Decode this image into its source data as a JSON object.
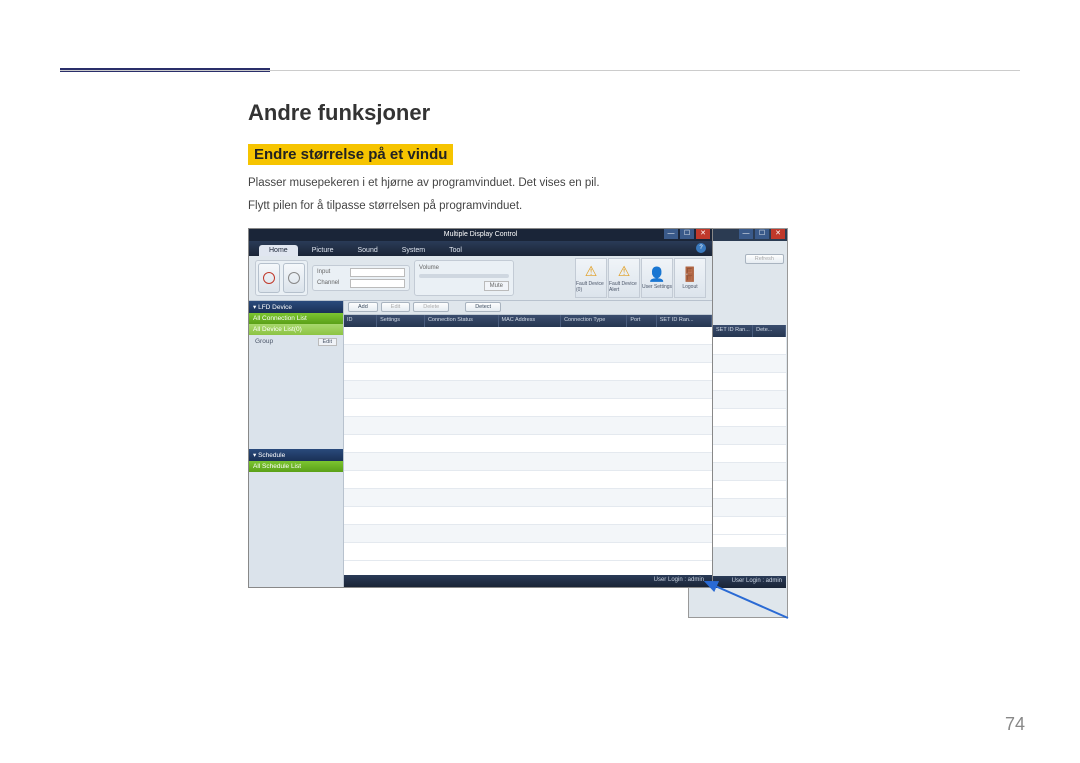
{
  "page": {
    "heading1": "Andre funksjoner",
    "heading2": "Endre størrelse på et vindu",
    "para1": "Plasser musepekeren i et hjørne av programvinduet. Det vises en pil.",
    "para2": "Flytt pilen for å tilpasse størrelsen på programvinduet.",
    "page_number": "74"
  },
  "app": {
    "title": "Multiple Display Control",
    "tabs": [
      "Home",
      "Picture",
      "Sound",
      "System",
      "Tool"
    ],
    "inputs": {
      "label1": "Input",
      "label2": "Channel"
    },
    "volume": {
      "label": "Volume",
      "mute": "Mute"
    },
    "tools": {
      "fault_device": "Fault Device (0)",
      "fault_alert": "Fault Device Alert",
      "user_settings": "User Settings",
      "logout": "Logout"
    },
    "sidebar": {
      "lfd": "LFD Device",
      "all_conn": "All Connection List",
      "all_dev": "All Device List(0)",
      "group": "Group",
      "edit": "Edit",
      "schedule": "Schedule",
      "all_sched": "All Schedule List"
    },
    "buttons": {
      "add": "Add",
      "edit": "Edit",
      "delete": "Delete",
      "detect": "Detect",
      "refresh": "Refresh"
    },
    "columns": {
      "id": "ID",
      "settings": "Settings",
      "conn": "Connection Status",
      "mac": "MAC Address",
      "ctype": "Connection Type",
      "port": "Port",
      "setid": "SET ID Ran...",
      "dete": "Dete..."
    },
    "status": "User Login : admin",
    "back_status": "User Login : admin"
  }
}
